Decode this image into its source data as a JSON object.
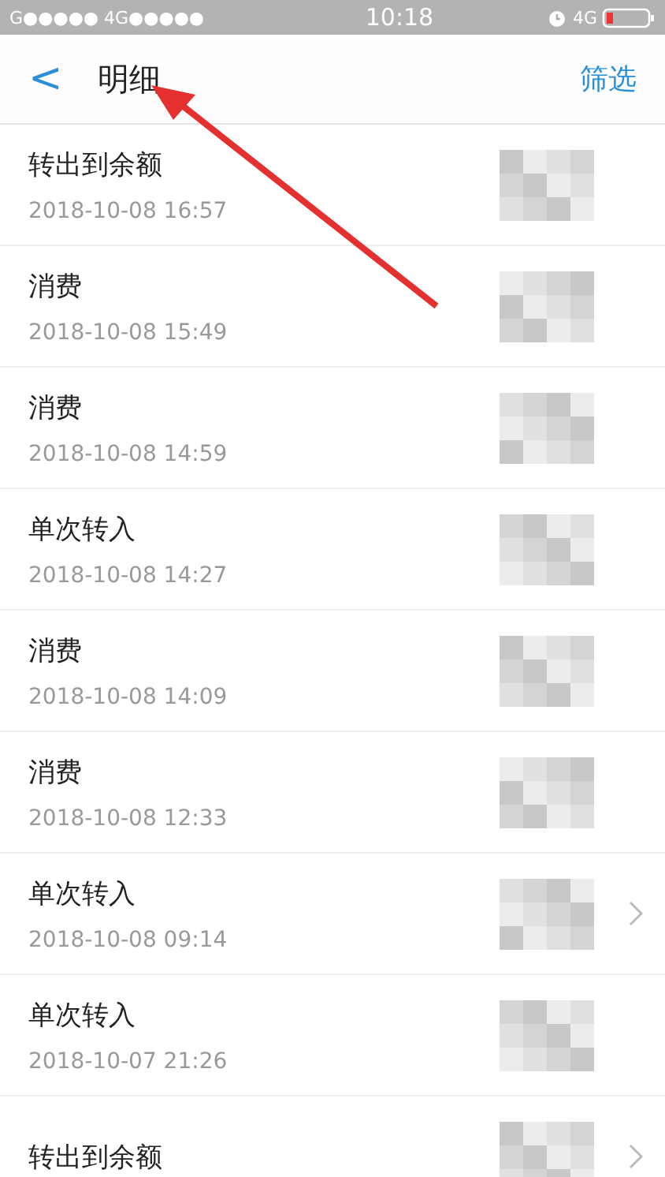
{
  "status_bar": {
    "carrier": "G●●●●● 4G●●●●●",
    "time": "10:18",
    "network": "4G"
  },
  "nav": {
    "back": "<",
    "title": "明细",
    "action": "筛选"
  },
  "rows": [
    {
      "title": "转出到余额",
      "date": "2018-10-08 16:57",
      "chevron": false
    },
    {
      "title": "消费",
      "date": "2018-10-08 15:49",
      "chevron": false
    },
    {
      "title": "消费",
      "date": "2018-10-08 14:59",
      "chevron": false
    },
    {
      "title": "单次转入",
      "date": "2018-10-08 14:27",
      "chevron": false
    },
    {
      "title": "消费",
      "date": "2018-10-08 14:09",
      "chevron": false
    },
    {
      "title": "消费",
      "date": "2018-10-08 12:33",
      "chevron": false
    },
    {
      "title": "单次转入",
      "date": "2018-10-08 09:14",
      "chevron": true
    },
    {
      "title": "单次转入",
      "date": "2018-10-07 21:26",
      "chevron": false
    },
    {
      "title": "转出到余额",
      "chevron": true
    }
  ]
}
